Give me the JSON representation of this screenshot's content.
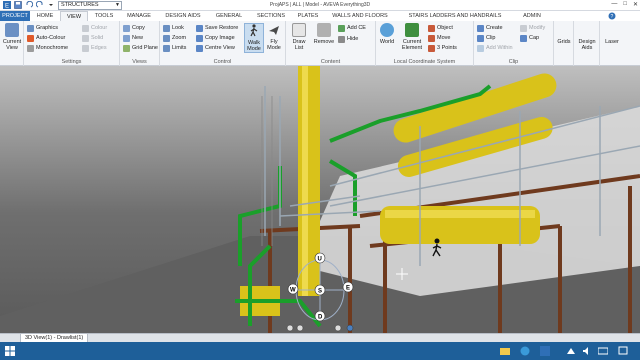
{
  "titlebar": {
    "module": "STRUCTURES",
    "title": "ProjAPS | ALL | Model - AVEVA Everything3D",
    "minimize": "—",
    "maximize": "□",
    "close": "✕"
  },
  "tabs": [
    "PROJECT",
    "HOME",
    "VIEW",
    "TOOLS",
    "MANAGE",
    "DESIGN AIDS",
    "GENERAL",
    "SECTIONS",
    "PLATES",
    "WALLS AND FLOORS",
    "STAIRS LADDERS AND HANDRAILS",
    "ADMIN"
  ],
  "ribbon": {
    "current_view": "Current View",
    "settings": {
      "items": [
        "Graphics",
        "Auto-Colour",
        "Monochrome"
      ],
      "items2": [
        "Colour",
        "Solid",
        "Edges"
      ],
      "label": "Settings"
    },
    "views": {
      "items": [
        "Copy",
        "New",
        "Grid Plane"
      ],
      "label": "Views"
    },
    "control": {
      "col1": [
        "Look",
        "Zoom",
        "Limits"
      ],
      "col2": [
        "Save Restore",
        "Copy Image",
        "Centre View"
      ],
      "walk": "Walk Mode",
      "fly": "Fly Mode",
      "label": "Control"
    },
    "content": {
      "draw": "Draw List",
      "remove": "Remove",
      "add_ce": "Add CE",
      "hide": "Hide",
      "label": "Content"
    },
    "lcs": {
      "world": "World",
      "current_element": "Current Element",
      "col": [
        "Object",
        "Move",
        "3 Points"
      ],
      "label": "Local Coordinate System"
    },
    "clip": {
      "col1": [
        "Create",
        "Clip",
        "Add Within"
      ],
      "col2": [
        "Modify",
        "Cap"
      ],
      "label": "Clip"
    },
    "grids": "Grids",
    "design_aids": "Design Aids",
    "laser": "Laser"
  },
  "viewport": {
    "compass": {
      "up": "U",
      "west": "W",
      "south": "S",
      "east": "E",
      "down": "D"
    }
  },
  "doc_tab": "3D View(1) - Drawlist(1)",
  "colors": {
    "project_tab": "#2f6fb6",
    "ribbon_bg": "#f3f5f8",
    "steel": "#6f3a1e",
    "pipe_yellow": "#d9c21a",
    "pipe_green": "#1a9f2a",
    "handrail": "#9aa7b3",
    "statusbar": "#1e5f99"
  }
}
